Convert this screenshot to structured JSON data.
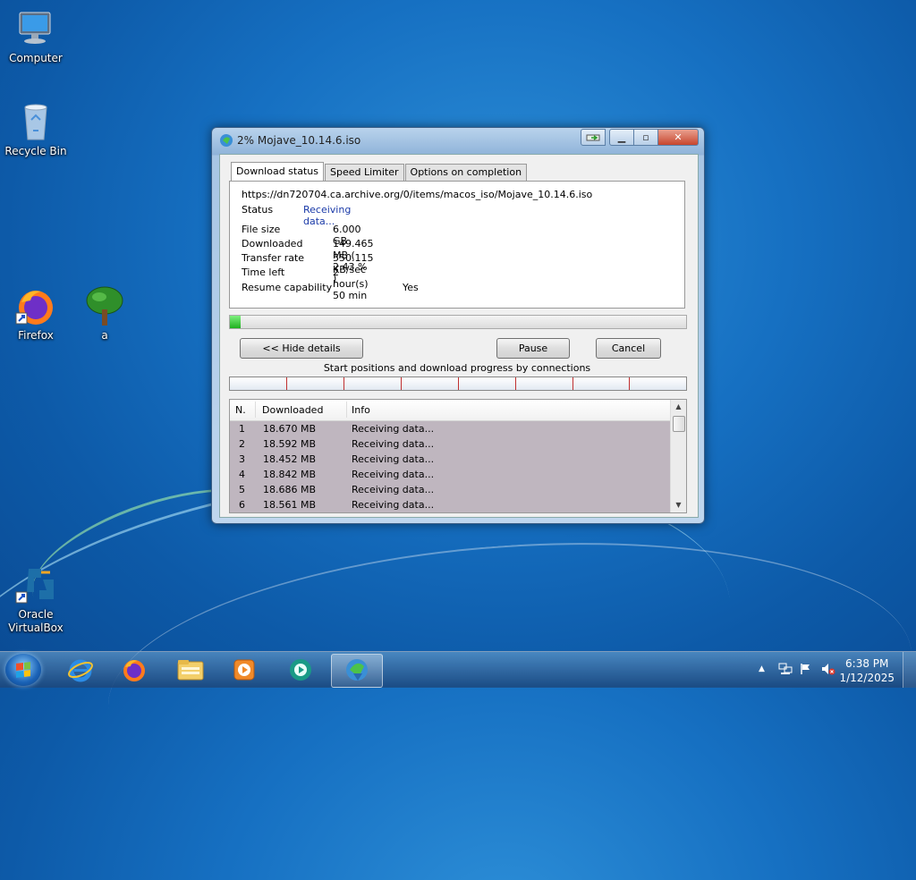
{
  "desktop": {
    "icons": [
      {
        "label": "Computer"
      },
      {
        "label": "Recycle Bin"
      },
      {
        "label": "Firefox"
      },
      {
        "label": "a"
      },
      {
        "label": "Oracle VirtualBox"
      }
    ]
  },
  "window": {
    "title": "2% Mojave_10.14.6.iso",
    "tabs": [
      "Download status",
      "Speed Limiter",
      "Options on completion"
    ],
    "url": "https://dn720704.ca.archive.org/0/items/macos_iso/Mojave_10.14.6.iso",
    "status_label": "Status",
    "status_value": "Receiving data...",
    "file_size_label": "File size",
    "file_size_value": "6.000  GB",
    "downloaded_label": "Downloaded",
    "downloaded_value": "149.465  MB  ( 2.43 % )",
    "transfer_rate_label": "Transfer rate",
    "transfer_rate_value": "550.115  KB/sec",
    "time_left_label": "Time left",
    "time_left_value": "2 hour(s) 50 min",
    "resume_label": "Resume capability",
    "resume_value": "Yes",
    "progress_percent": 2.43,
    "buttons": {
      "hide_details": "<< Hide details",
      "pause": "Pause",
      "cancel": "Cancel"
    },
    "connections_label": "Start positions and download progress by connections",
    "list": {
      "columns": [
        "N.",
        "Downloaded",
        "Info"
      ],
      "rows": [
        {
          "n": "1",
          "downloaded": "18.670  MB",
          "info": "Receiving data..."
        },
        {
          "n": "2",
          "downloaded": "18.592  MB",
          "info": "Receiving data..."
        },
        {
          "n": "3",
          "downloaded": "18.452  MB",
          "info": "Receiving data..."
        },
        {
          "n": "4",
          "downloaded": "18.842  MB",
          "info": "Receiving data..."
        },
        {
          "n": "5",
          "downloaded": "18.686  MB",
          "info": "Receiving data..."
        },
        {
          "n": "6",
          "downloaded": "18.561  MB",
          "info": "Receiving data..."
        }
      ]
    }
  },
  "taskbar": {
    "items": [
      "start-button",
      "internet-explorer-icon",
      "firefox-icon",
      "file-explorer-icon",
      "media-player-icon",
      "app-icon",
      "download-manager-icon"
    ],
    "time": "6:38 PM",
    "date": "1/12/2025"
  }
}
